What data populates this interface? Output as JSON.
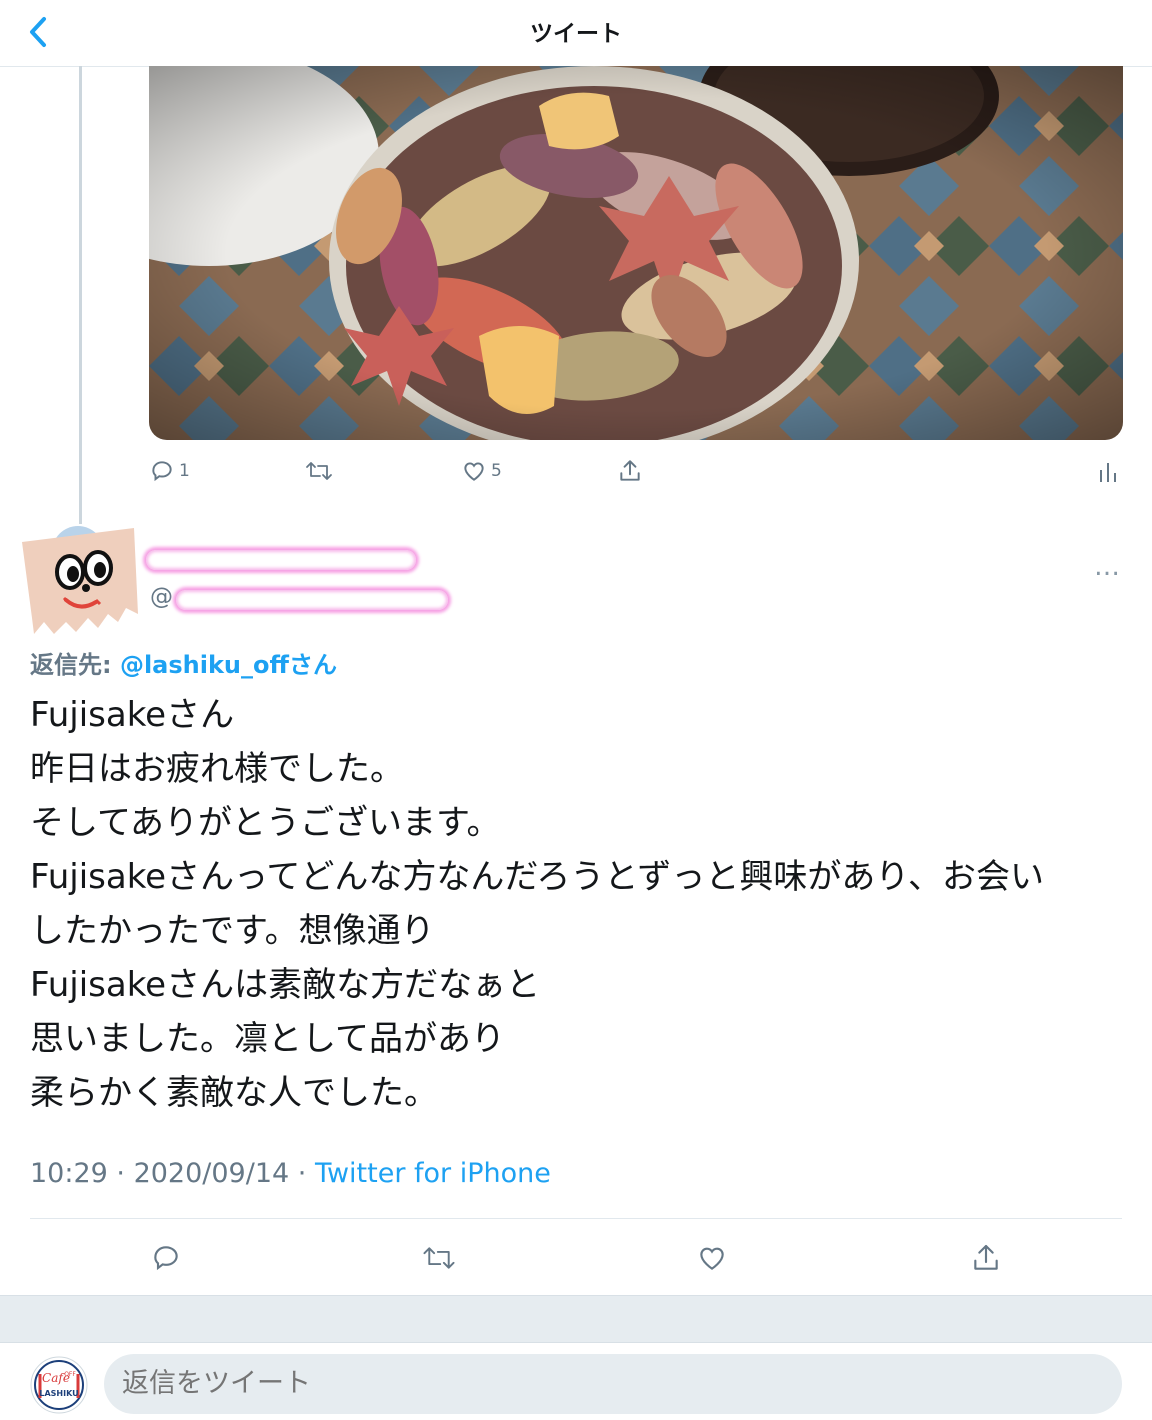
{
  "header": {
    "title": "ツイート",
    "back_icon": "chevron-left-icon"
  },
  "colors": {
    "accent": "#1da1f2",
    "secondary_text": "#657786",
    "border": "#e1e8ed",
    "redaction_glow": "#f6a0e4"
  },
  "parent_tweet": {
    "actions": {
      "reply_count": "1",
      "retweet_count": "",
      "like_count": "5"
    }
  },
  "reply": {
    "handle_prefix": "@",
    "reply_to_label": "返信先: ",
    "reply_to_link": "@lashiku_offさん",
    "more_label": "…",
    "body_lines": [
      "Fujisakeさん",
      "昨日はお疲れ様でした。",
      "そしてありがとうございます。",
      "Fujisakeさんってどんな方なんだろうとずっと興味があり、お会い",
      "したかったです。想像通り",
      "Fujisakeさんは素敵な方だなぁと",
      "思いました。凛として品があり",
      "柔らかく素敵な人でした。"
    ],
    "time": "10:29",
    "separator": " · ",
    "date": "2020/09/14",
    "source": "Twitter for iPhone"
  },
  "composer": {
    "placeholder": "返信をツイート",
    "avatar_text": {
      "top": "Cafe",
      "tag": "OFF",
      "bottom": "LASHIKU"
    }
  }
}
